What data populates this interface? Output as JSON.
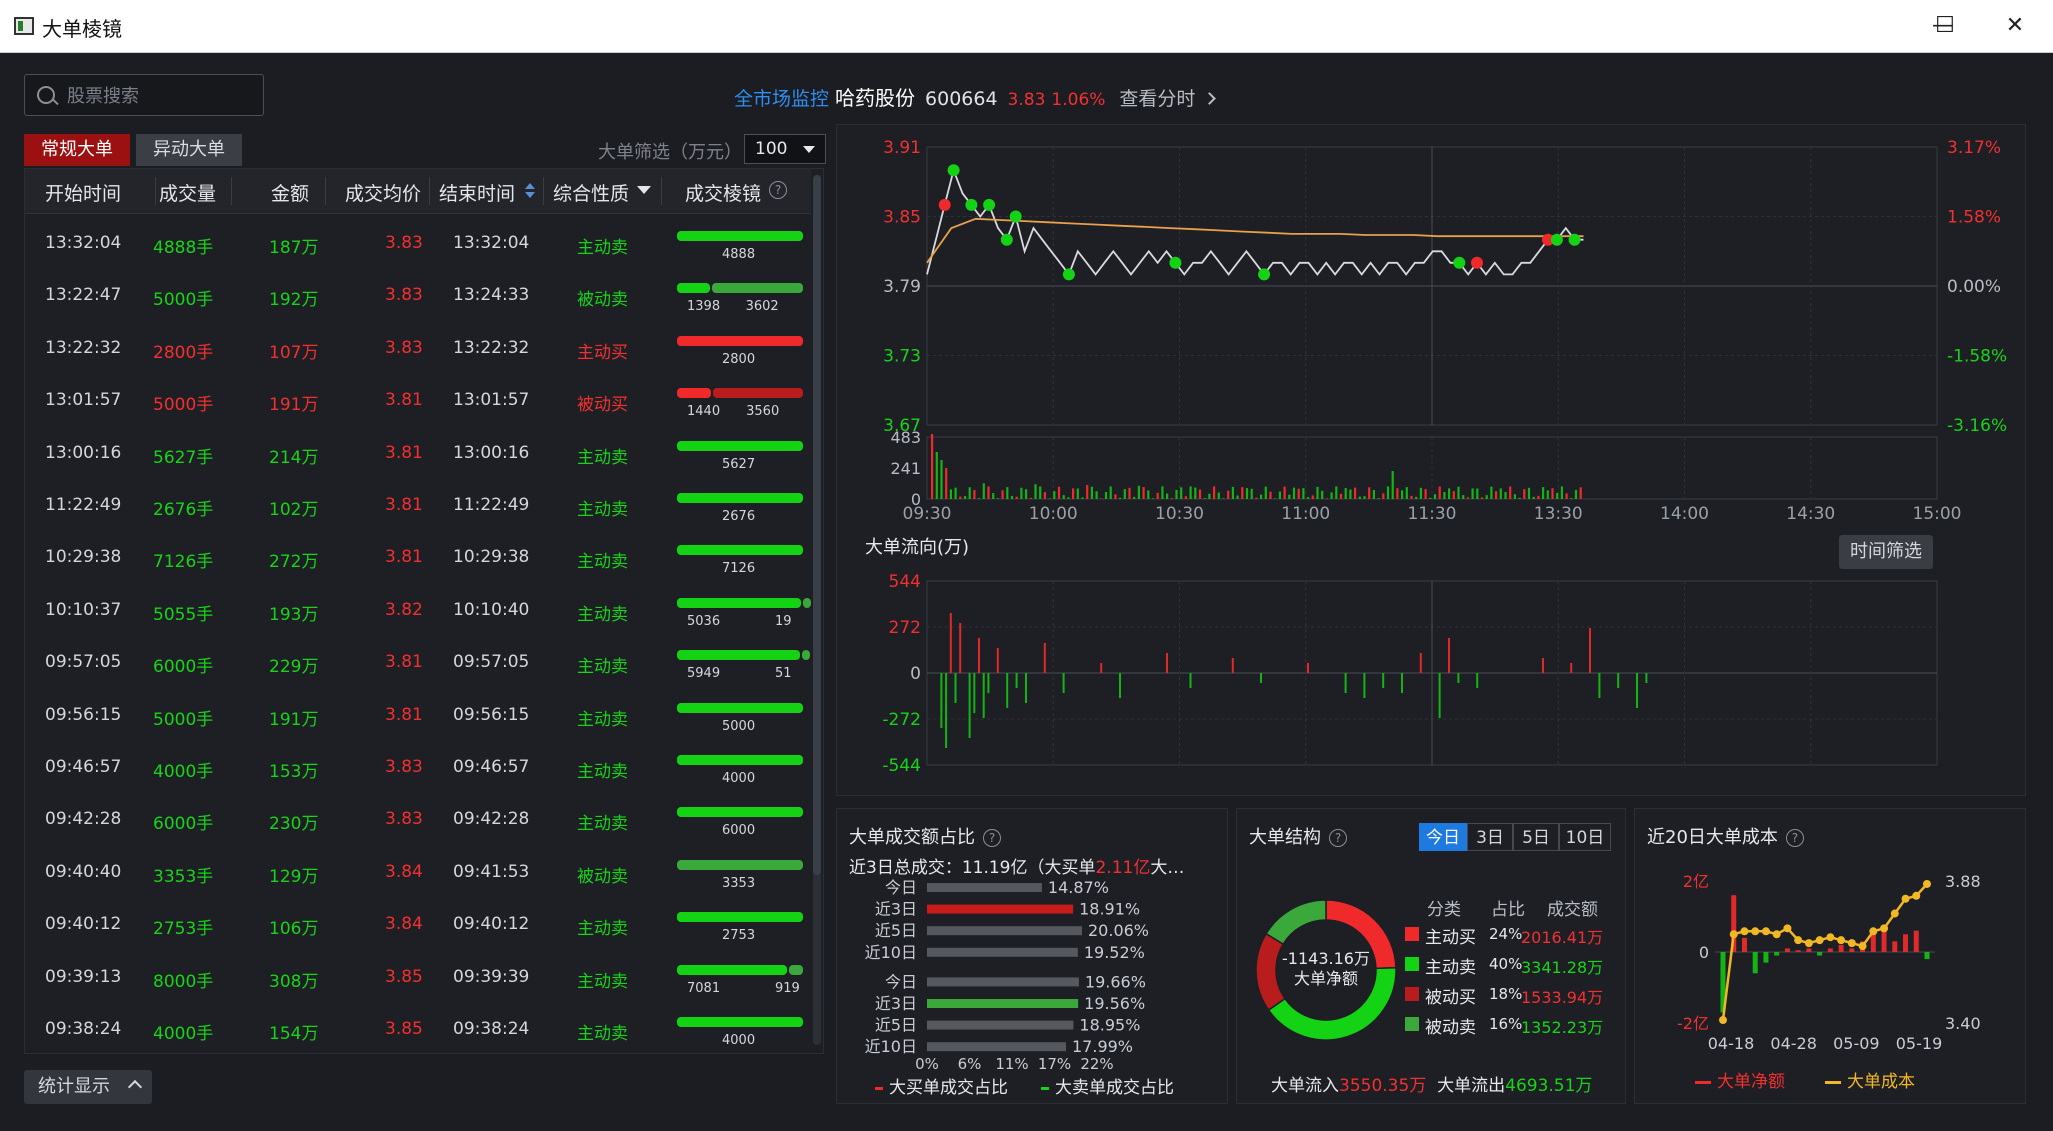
{
  "window": {
    "title": "大单棱镜",
    "minimize_label": "—",
    "maximize_label": "☐",
    "close_label": "✕"
  },
  "search": {
    "placeholder": "股票搜索"
  },
  "tabs": [
    {
      "label": "常规大单",
      "active": true
    },
    {
      "label": "异动大单",
      "active": false
    }
  ],
  "filter": {
    "label": "大单筛选（万元）",
    "value": "100"
  },
  "stats_button": {
    "label": "统计显示"
  },
  "stock": {
    "market_link": "全市场监控",
    "name": "哈药股份",
    "code": "600664",
    "price": "3.83",
    "change_pct": "1.06%",
    "fenshi_link": "查看分时"
  },
  "table": {
    "columns": [
      "开始时间",
      "成交量",
      "金额",
      "成交均价",
      "结束时间",
      "综合性质",
      "成交棱镜"
    ],
    "rows": [
      {
        "start": "13:32:04",
        "vol": "4888手",
        "amt": "187万",
        "price": "3.83",
        "end": "13:32:04",
        "type": "主动卖",
        "color": "green",
        "bars": [
          4888
        ],
        "bar_colors": [
          "#14d214"
        ]
      },
      {
        "start": "13:22:47",
        "vol": "5000手",
        "amt": "192万",
        "price": "3.83",
        "end": "13:24:33",
        "type": "被动卖",
        "color": "green",
        "bars": [
          1398,
          3602
        ],
        "bar_colors": [
          "#14d214",
          "#3aa83a"
        ]
      },
      {
        "start": "13:22:32",
        "vol": "2800手",
        "amt": "107万",
        "price": "3.83",
        "end": "13:22:32",
        "type": "主动买",
        "color": "red",
        "bars": [
          2800
        ],
        "bar_colors": [
          "#f02a2a"
        ]
      },
      {
        "start": "13:01:57",
        "vol": "5000手",
        "amt": "191万",
        "price": "3.81",
        "end": "13:01:57",
        "type": "被动买",
        "color": "red",
        "bars": [
          1440,
          3560
        ],
        "bar_colors": [
          "#f02a2a",
          "#b81c1c"
        ]
      },
      {
        "start": "13:00:16",
        "vol": "5627手",
        "amt": "214万",
        "price": "3.81",
        "end": "13:00:16",
        "type": "主动卖",
        "color": "green",
        "bars": [
          5627
        ],
        "bar_colors": [
          "#14d214"
        ]
      },
      {
        "start": "11:22:49",
        "vol": "2676手",
        "amt": "102万",
        "price": "3.81",
        "end": "11:22:49",
        "type": "主动卖",
        "color": "green",
        "bars": [
          2676
        ],
        "bar_colors": [
          "#14d214"
        ]
      },
      {
        "start": "10:29:38",
        "vol": "7126手",
        "amt": "272万",
        "price": "3.81",
        "end": "10:29:38",
        "type": "主动卖",
        "color": "green",
        "bars": [
          7126
        ],
        "bar_colors": [
          "#14d214"
        ]
      },
      {
        "start": "10:10:37",
        "vol": "5055手",
        "amt": "193万",
        "price": "3.82",
        "end": "10:10:40",
        "type": "主动卖",
        "color": "green",
        "bars": [
          5036,
          19
        ],
        "bar_colors": [
          "#14d214",
          "#3aa83a"
        ]
      },
      {
        "start": "09:57:05",
        "vol": "6000手",
        "amt": "229万",
        "price": "3.81",
        "end": "09:57:05",
        "type": "主动卖",
        "color": "green",
        "bars": [
          5949,
          51
        ],
        "bar_colors": [
          "#14d214",
          "#3aa83a"
        ]
      },
      {
        "start": "09:56:15",
        "vol": "5000手",
        "amt": "191万",
        "price": "3.81",
        "end": "09:56:15",
        "type": "主动卖",
        "color": "green",
        "bars": [
          5000
        ],
        "bar_colors": [
          "#14d214"
        ]
      },
      {
        "start": "09:46:57",
        "vol": "4000手",
        "amt": "153万",
        "price": "3.83",
        "end": "09:46:57",
        "type": "主动卖",
        "color": "green",
        "bars": [
          4000
        ],
        "bar_colors": [
          "#14d214"
        ]
      },
      {
        "start": "09:42:28",
        "vol": "6000手",
        "amt": "230万",
        "price": "3.83",
        "end": "09:42:28",
        "type": "主动卖",
        "color": "green",
        "bars": [
          6000
        ],
        "bar_colors": [
          "#14d214"
        ]
      },
      {
        "start": "09:40:40",
        "vol": "3353手",
        "amt": "129万",
        "price": "3.84",
        "end": "09:41:53",
        "type": "被动卖",
        "color": "green",
        "bars": [
          3353
        ],
        "bar_colors": [
          "#3aa83a"
        ]
      },
      {
        "start": "09:40:12",
        "vol": "2753手",
        "amt": "106万",
        "price": "3.84",
        "end": "09:40:12",
        "type": "主动卖",
        "color": "green",
        "bars": [
          2753
        ],
        "bar_colors": [
          "#14d214"
        ]
      },
      {
        "start": "09:39:13",
        "vol": "8000手",
        "amt": "308万",
        "price": "3.85",
        "end": "09:39:39",
        "type": "主动卖",
        "color": "green",
        "bars": [
          7081,
          919
        ],
        "bar_colors": [
          "#14d214",
          "#3aa83a"
        ]
      },
      {
        "start": "09:38:24",
        "vol": "4000手",
        "amt": "154万",
        "price": "3.85",
        "end": "09:38:24",
        "type": "主动卖",
        "color": "green",
        "bars": [
          4000
        ],
        "bar_colors": [
          "#14d214"
        ]
      }
    ]
  },
  "colors": {
    "up": "#f23030",
    "down": "#18d418",
    "accent": "#1f7ae0"
  },
  "chart_data": [
    {
      "id": "intraday",
      "type": "line",
      "price_ticks": [
        "3.91",
        "3.85",
        "3.79",
        "3.73",
        "3.67"
      ],
      "pct_ticks": [
        "3.17%",
        "1.58%",
        "0.00%",
        "-1.58%",
        "-3.16%"
      ],
      "vol_ticks": [
        "483",
        "241",
        "0"
      ],
      "time_ticks": [
        "09:30",
        "10:00",
        "10:30",
        "11:00",
        "11:30",
        "13:30",
        "14:00",
        "14:30",
        "15:00"
      ],
      "ylim": [
        3.67,
        3.91
      ],
      "price_series": [
        3.8,
        3.83,
        3.86,
        3.89,
        3.87,
        3.86,
        3.85,
        3.86,
        3.84,
        3.83,
        3.85,
        3.82,
        3.84,
        3.83,
        3.82,
        3.81,
        3.8,
        3.82,
        3.81,
        3.8,
        3.81,
        3.82,
        3.81,
        3.8,
        3.81,
        3.82,
        3.81,
        3.82,
        3.81,
        3.8,
        3.81,
        3.81,
        3.82,
        3.81,
        3.8,
        3.81,
        3.82,
        3.81,
        3.8,
        3.81,
        3.81,
        3.8,
        3.81,
        3.81,
        3.8,
        3.81,
        3.8,
        3.81,
        3.81,
        3.8,
        3.81,
        3.8,
        3.81,
        3.81,
        3.8,
        3.81,
        3.81,
        3.82,
        3.82,
        3.81,
        3.81,
        3.8,
        3.81,
        3.8,
        3.81,
        3.8,
        3.8,
        3.81,
        3.81,
        3.82,
        3.83,
        3.83,
        3.84,
        3.83,
        3.83
      ],
      "avg_series": [
        3.81,
        3.84,
        3.848,
        3.847,
        3.846,
        3.845,
        3.844,
        3.843,
        3.842,
        3.841,
        3.84,
        3.839,
        3.838,
        3.837,
        3.836,
        3.835,
        3.835,
        3.835,
        3.834,
        3.834,
        3.834,
        3.833,
        3.833,
        3.833,
        3.833,
        3.833,
        3.833,
        3.833
      ]
    },
    {
      "id": "flow",
      "type": "bar",
      "title": "大单流向(万)",
      "y_ticks": [
        "544",
        "272",
        "0",
        "-272",
        "-544"
      ],
      "ylim": [
        -544,
        544
      ],
      "filter_button": "时间筛选"
    },
    {
      "id": "ratio",
      "type": "bar",
      "title": "大单成交额占比",
      "subtitle_prefix": "近3日总成交：11.19亿（大买单",
      "subtitle_value": "2.11亿",
      "subtitle_suffix": "大…",
      "categories": [
        "今日",
        "近3日",
        "近5日",
        "近10日",
        "今日",
        "近3日",
        "近5日",
        "近10日"
      ],
      "values": [
        14.87,
        18.91,
        20.06,
        19.52,
        19.66,
        19.56,
        18.95,
        17.99
      ],
      "labels": [
        "14.87%",
        "18.91%",
        "20.06%",
        "19.52%",
        "19.66%",
        "19.56%",
        "18.95%",
        "17.99%"
      ],
      "x_ticks": [
        "0%",
        "6%",
        "11%",
        "17%",
        "22%"
      ],
      "xlim": [
        0,
        22
      ],
      "legend": [
        "大买单成交占比",
        "大卖单成交占比"
      ]
    },
    {
      "id": "structure",
      "type": "pie",
      "title": "大单结构",
      "segments": [
        "今日",
        "3日",
        "5日",
        "10日"
      ],
      "center_value": "-1143.16万",
      "center_label": "大单净额",
      "headers": [
        "分类",
        "占比",
        "成交额"
      ],
      "items": [
        {
          "name": "主动买",
          "pct": "24%",
          "value": "2016.41万",
          "color": "#f02a2a",
          "frac": 0.24
        },
        {
          "name": "主动卖",
          "pct": "40%",
          "value": "3341.28万",
          "color": "#14d214",
          "frac": 0.4
        },
        {
          "name": "被动买",
          "pct": "18%",
          "value": "1533.94万",
          "color": "#b81c1c",
          "frac": 0.18
        },
        {
          "name": "被动卖",
          "pct": "16%",
          "value": "1352.23万",
          "color": "#3aa83a",
          "frac": 0.16
        }
      ],
      "inflow_label": "大单流入",
      "inflow_value": "3550.35万",
      "outflow_label": "大单流出",
      "outflow_value": "4693.51万"
    },
    {
      "id": "cost20",
      "type": "line",
      "title": "近20日大单成本",
      "left_ticks": [
        "2亿",
        "0",
        "-2亿"
      ],
      "right_ticks": [
        "3.88",
        "3.40"
      ],
      "x_ticks": [
        "04-18",
        "04-28",
        "05-09",
        "05-19"
      ],
      "net_values": [
        -1.7,
        1.6,
        0.4,
        -0.6,
        -0.3,
        -0.1,
        0.1,
        0.05,
        0.1,
        -0.1,
        0.1,
        0.2,
        0.1,
        0.3,
        0.5,
        0.6,
        0.3,
        0.5,
        0.6,
        -0.2
      ],
      "cost_values": [
        3.41,
        3.7,
        3.71,
        3.71,
        3.71,
        3.7,
        3.72,
        3.68,
        3.67,
        3.68,
        3.69,
        3.68,
        3.67,
        3.66,
        3.71,
        3.72,
        3.77,
        3.82,
        3.83,
        3.87
      ],
      "legend": [
        "大单净额",
        "大单成本"
      ]
    }
  ]
}
